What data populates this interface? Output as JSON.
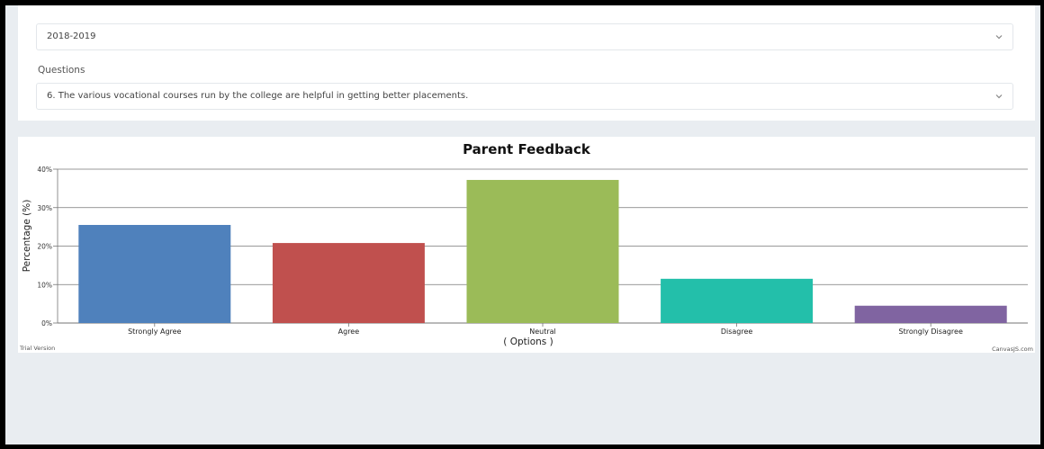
{
  "form": {
    "year_select": {
      "value": "2018-2019"
    },
    "questions_label": "Questions",
    "question_select": {
      "value": "6. The various vocational courses run by the college are helpful in getting better placements."
    }
  },
  "chart_data": {
    "type": "bar",
    "title": "Parent Feedback",
    "xlabel": "( Options )",
    "ylabel": "Percentage (%)",
    "categories": [
      "Strongly Agree",
      "Agree",
      "Neutral",
      "Disagree",
      "Strongly Disagree"
    ],
    "values": [
      25.5,
      20.8,
      37.2,
      11.5,
      4.5
    ],
    "colors": [
      "#4f81bc",
      "#c0504e",
      "#9bbb58",
      "#23bfaa",
      "#8064a1"
    ],
    "ylim": [
      0,
      40
    ],
    "yticks": [
      0,
      10,
      20,
      30,
      40
    ],
    "ytick_labels": [
      "0%",
      "10%",
      "20%",
      "30%",
      "40%"
    ],
    "grid": true,
    "legend": "none",
    "footer_left": "Trial Version",
    "footer_right": "CanvasJS.com"
  }
}
